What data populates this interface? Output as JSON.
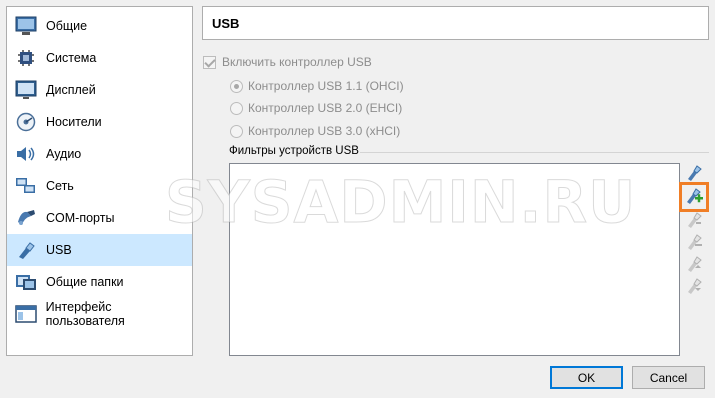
{
  "sidebar": {
    "items": [
      {
        "label": "Общие",
        "icon": "general-icon"
      },
      {
        "label": "Система",
        "icon": "system-icon"
      },
      {
        "label": "Дисплей",
        "icon": "display-icon"
      },
      {
        "label": "Носители",
        "icon": "storage-icon"
      },
      {
        "label": "Аудио",
        "icon": "audio-icon"
      },
      {
        "label": "Сеть",
        "icon": "network-icon"
      },
      {
        "label": "COM-порты",
        "icon": "serial-ports-icon"
      },
      {
        "label": "USB",
        "icon": "usb-icon",
        "selected": true
      },
      {
        "label": "Общие папки",
        "icon": "shared-folders-icon"
      },
      {
        "label": "Интерфейс пользователя",
        "icon": "user-interface-icon"
      }
    ]
  },
  "header": {
    "title": "USB"
  },
  "usb": {
    "enable_label": "Включить контроллер USB",
    "enable_checked": true,
    "controllers": [
      {
        "label": "Контроллер USB 1.1 (OHCI)",
        "checked": true
      },
      {
        "label": "Контроллер USB 2.0 (EHCI)",
        "checked": false
      },
      {
        "label": "Контроллер USB 3.0 (xHCI)",
        "checked": false
      }
    ],
    "filters_title": "Фильтры устройств USB",
    "toolbar": [
      {
        "icon": "add-filter-icon"
      },
      {
        "icon": "add-device-filter-icon",
        "highlighted": true
      },
      {
        "icon": "edit-filter-icon"
      },
      {
        "icon": "remove-filter-icon"
      },
      {
        "icon": "move-up-filter-icon"
      },
      {
        "icon": "move-down-filter-icon"
      }
    ]
  },
  "watermark": "SYSADMIN.RU",
  "buttons": {
    "ok": "OK",
    "cancel": "Cancel"
  },
  "colors": {
    "selection": "#cce8ff",
    "highlight": "#f07e26",
    "ok_border": "#0078d7"
  }
}
